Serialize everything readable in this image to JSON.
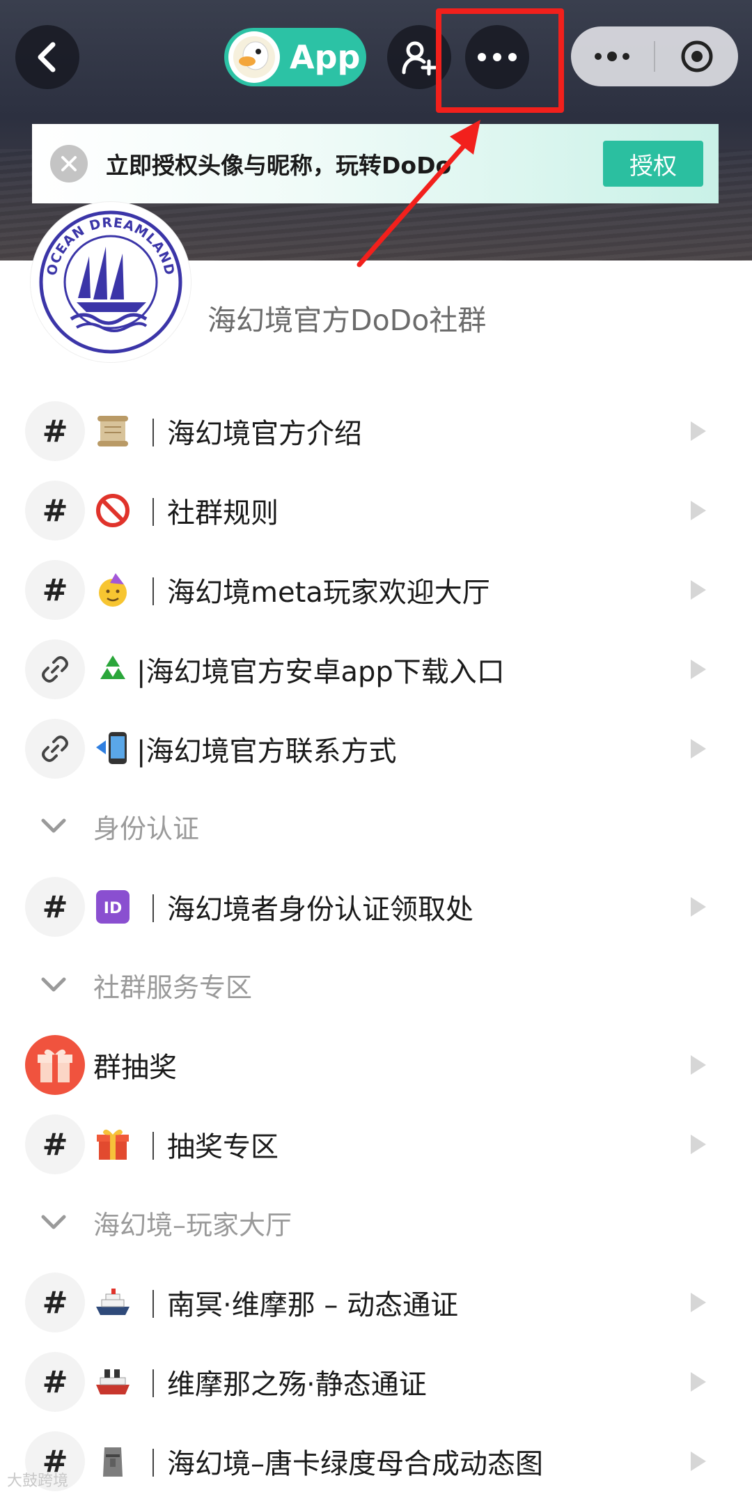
{
  "topbar": {
    "app_label": "App",
    "back_icon": "chevron-left-icon",
    "add_user_icon": "add-user-icon",
    "more_icon": "ellipsis-icon",
    "capsule_more_icon": "ellipsis-icon",
    "capsule_close_icon": "target-icon"
  },
  "banner": {
    "text": "立即授权头像与昵称，玩转DoDo",
    "button": "授权"
  },
  "server": {
    "name": "海幻境官方DoDo社群",
    "logo_text": "OCEAN DREAMLAND"
  },
  "channels_top": [
    {
      "icon": "#",
      "emoji": "scroll-emoji",
      "name": "｜海幻境官方介绍"
    },
    {
      "icon": "#",
      "emoji": "no-entry-emoji",
      "name": "｜社群规则"
    },
    {
      "icon": "#",
      "emoji": "party-face-emoji",
      "name": "｜海幻境meta玩家欢迎大厅"
    },
    {
      "icon": "link",
      "emoji": "recycle-emoji",
      "name": "|海幻境官方安卓app下载入口"
    },
    {
      "icon": "link",
      "emoji": "phone-arrow-emoji",
      "name": "|海幻境官方联系方式"
    }
  ],
  "categories": {
    "identity": "身份认证",
    "service": "社群服务专区",
    "lobby": "海幻境–玩家大厅"
  },
  "channel_identity": {
    "icon": "#",
    "emoji": "id-emoji",
    "name": "｜海幻境者身份认证领取处"
  },
  "channel_lottery_group": {
    "name": "群抽奖"
  },
  "channel_lottery_zone": {
    "icon": "#",
    "emoji": "gift-emoji",
    "name": "｜抽奖专区"
  },
  "channels_lobby": [
    {
      "icon": "#",
      "emoji": "cruise-ship-emoji",
      "name": "｜南冥·维摩那 – 动态通证"
    },
    {
      "icon": "#",
      "emoji": "ship-emoji",
      "name": "｜维摩那之殇·静态通证"
    },
    {
      "icon": "#",
      "emoji": "moai-emoji",
      "name": "｜海幻境–唐卡绿度母合成动态图"
    }
  ],
  "watermark": "大鼓跨境"
}
